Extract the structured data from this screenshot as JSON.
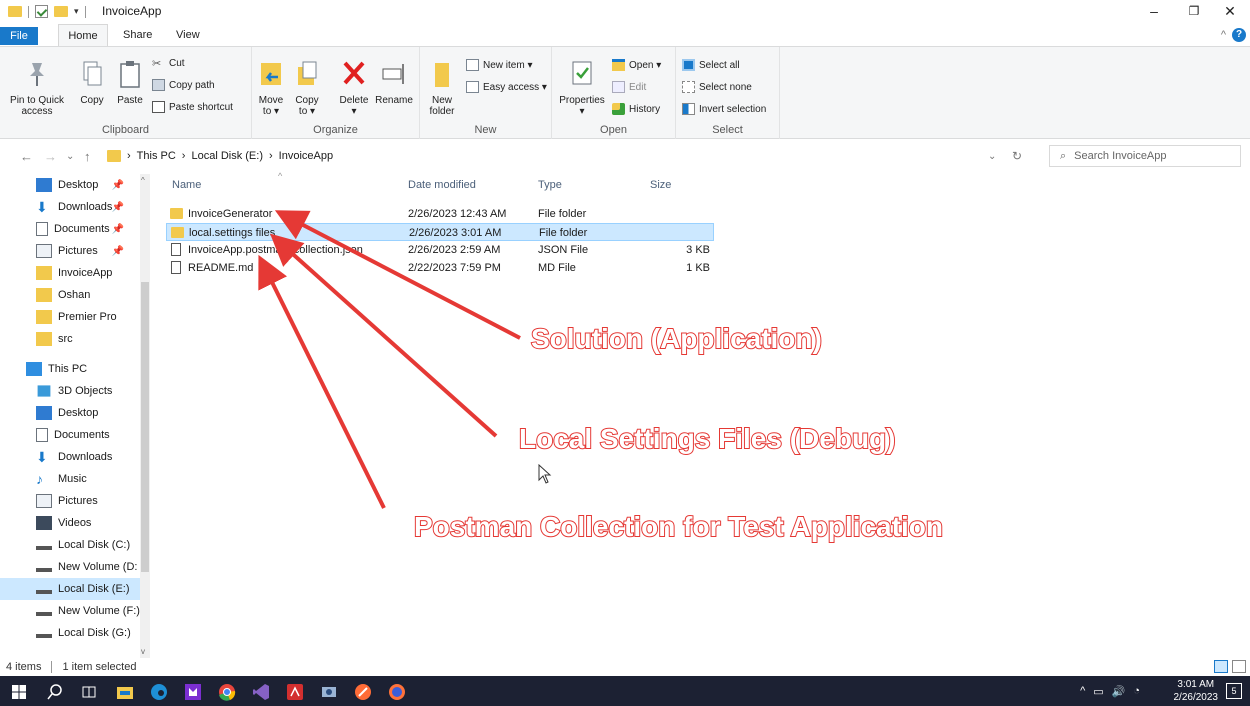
{
  "window": {
    "title": "InvoiceApp"
  },
  "tabs": {
    "file": "File",
    "home": "Home",
    "share": "Share",
    "view": "View"
  },
  "ribbon": {
    "clipboard": {
      "label": "Clipboard",
      "pin_line1": "Pin to Quick",
      "pin_line2": "access",
      "copy": "Copy",
      "paste": "Paste",
      "cut": "Cut",
      "copy_path": "Copy path",
      "paste_shortcut": "Paste shortcut"
    },
    "organize": {
      "label": "Organize",
      "move_to": "Move",
      "move_to2": "to ▾",
      "copy_to": "Copy",
      "copy_to2": "to ▾",
      "delete": "Delete",
      "delete2": "▾",
      "rename": "Rename"
    },
    "new": {
      "label": "New",
      "new_folder1": "New",
      "new_folder2": "folder",
      "new_item": "New item ▾",
      "easy_access": "Easy access ▾"
    },
    "open": {
      "label": "Open",
      "properties": "Properties",
      "properties2": "▾",
      "open": "Open ▾",
      "edit": "Edit",
      "history": "History"
    },
    "select": {
      "label": "Select",
      "select_all": "Select all",
      "select_none": "Select none",
      "invert": "Invert selection"
    }
  },
  "address": {
    "this_pc": "This PC",
    "disk": "Local Disk (E:)",
    "folder": "InvoiceApp",
    "search_placeholder": "Search InvoiceApp"
  },
  "sidebar": {
    "quick": [
      {
        "label": "Desktop"
      },
      {
        "label": "Downloads"
      },
      {
        "label": "Documents"
      },
      {
        "label": "Pictures"
      },
      {
        "label": "InvoiceApp"
      },
      {
        "label": "Oshan"
      },
      {
        "label": "Premier Pro"
      },
      {
        "label": "src"
      }
    ],
    "this_pc": "This PC",
    "pc": [
      {
        "label": "3D Objects"
      },
      {
        "label": "Desktop"
      },
      {
        "label": "Documents"
      },
      {
        "label": "Downloads"
      },
      {
        "label": "Music"
      },
      {
        "label": "Pictures"
      },
      {
        "label": "Videos"
      },
      {
        "label": "Local Disk (C:)"
      },
      {
        "label": "New Volume (D:"
      },
      {
        "label": "Local Disk (E:)"
      },
      {
        "label": "New Volume (F:)"
      },
      {
        "label": "Local Disk (G:)"
      }
    ]
  },
  "columns": {
    "name": "Name",
    "date": "Date modified",
    "type": "Type",
    "size": "Size"
  },
  "files": [
    {
      "name": "InvoiceGenerator",
      "date": "2/26/2023 12:43 AM",
      "type": "File folder",
      "size": ""
    },
    {
      "name": "local.settings files",
      "date": "2/26/2023 3:01 AM",
      "type": "File folder",
      "size": ""
    },
    {
      "name": "InvoiceApp.postman_collection.json",
      "date": "2/26/2023 2:59 AM",
      "type": "JSON File",
      "size": "3 KB"
    },
    {
      "name": "README.md",
      "date": "2/22/2023 7:59 PM",
      "type": "MD File",
      "size": "1 KB"
    }
  ],
  "status": {
    "count": "4 items",
    "selected": "1 item selected"
  },
  "taskbar": {
    "time": "3:01 AM",
    "date": "2/26/2023",
    "notif_count": "5"
  },
  "annotations": {
    "a1": "Solution (Application)",
    "a2": "Local Settings Files (Debug)",
    "a3": "Postman Collection for Test Application"
  },
  "colors": {
    "accent": "#1979ca",
    "selection": "#cce8ff",
    "arrow": "#e53935",
    "folder": "#f2c94c"
  }
}
